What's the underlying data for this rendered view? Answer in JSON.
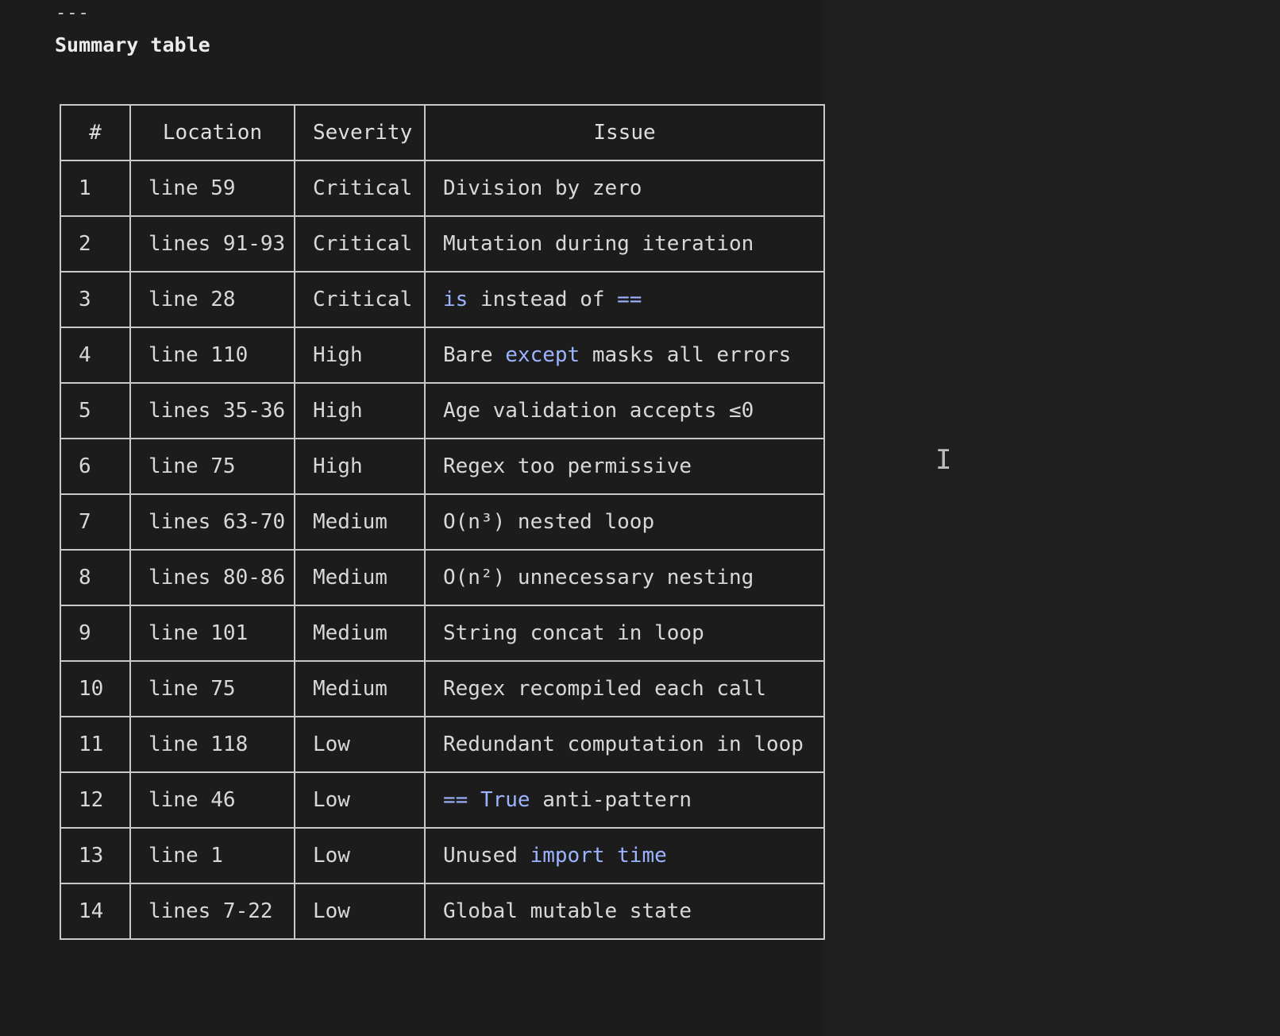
{
  "document": {
    "hr_marker": "---",
    "section_title": "Summary table",
    "cursor_glyph": "I"
  },
  "table": {
    "headers": [
      "#",
      "Location",
      "Severity",
      "Issue"
    ],
    "rows": [
      {
        "num": "1",
        "location": "line 59",
        "severity": "Critical",
        "issue": [
          {
            "t": "Division by zero"
          }
        ]
      },
      {
        "num": "2",
        "location": "lines 91-93",
        "severity": "Critical",
        "issue": [
          {
            "t": "Mutation during iteration"
          }
        ]
      },
      {
        "num": "3",
        "location": "line 28",
        "severity": "Critical",
        "issue": [
          {
            "t": "is",
            "code": true
          },
          {
            "t": " instead of "
          },
          {
            "t": "==",
            "code": true
          }
        ]
      },
      {
        "num": "4",
        "location": "line 110",
        "severity": "High",
        "issue": [
          {
            "t": "Bare "
          },
          {
            "t": "except",
            "code": true
          },
          {
            "t": " masks all errors"
          }
        ]
      },
      {
        "num": "5",
        "location": "lines 35-36",
        "severity": "High",
        "issue": [
          {
            "t": "Age validation accepts ≤0"
          }
        ]
      },
      {
        "num": "6",
        "location": "line 75",
        "severity": "High",
        "issue": [
          {
            "t": "Regex too permissive"
          }
        ]
      },
      {
        "num": "7",
        "location": "lines 63-70",
        "severity": "Medium",
        "issue": [
          {
            "t": "O(n³) nested loop"
          }
        ]
      },
      {
        "num": "8",
        "location": "lines 80-86",
        "severity": "Medium",
        "issue": [
          {
            "t": "O(n²) unnecessary nesting"
          }
        ]
      },
      {
        "num": "9",
        "location": "line 101",
        "severity": "Medium",
        "issue": [
          {
            "t": "String concat in loop"
          }
        ]
      },
      {
        "num": "10",
        "location": "line 75",
        "severity": "Medium",
        "issue": [
          {
            "t": "Regex recompiled each call"
          }
        ]
      },
      {
        "num": "11",
        "location": "line 118",
        "severity": "Low",
        "issue": [
          {
            "t": "Redundant computation in loop"
          }
        ]
      },
      {
        "num": "12",
        "location": "line 46",
        "severity": "Low",
        "issue": [
          {
            "t": "== True",
            "code": true
          },
          {
            "t": " anti-pattern"
          }
        ]
      },
      {
        "num": "13",
        "location": "line 1",
        "severity": "Low",
        "issue": [
          {
            "t": "Unused "
          },
          {
            "t": "import time",
            "code": true
          }
        ]
      },
      {
        "num": "14",
        "location": "lines 7-22",
        "severity": "Low",
        "issue": [
          {
            "t": "Global mutable state"
          }
        ]
      }
    ]
  },
  "colors": {
    "background": "#1e1e1e",
    "text": "#d8d8d8",
    "inline_code": "#9cb4ff",
    "border": "#c8c8c8"
  }
}
